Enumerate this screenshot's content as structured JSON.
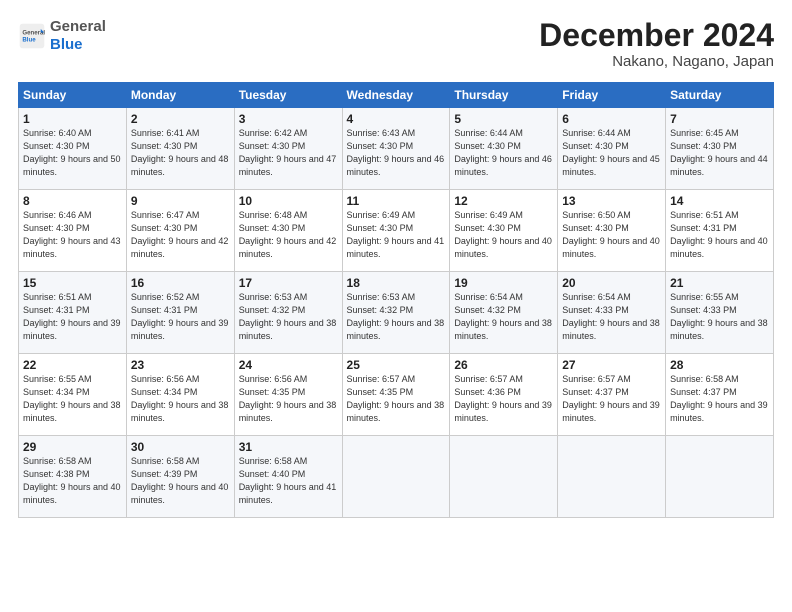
{
  "header": {
    "logo_general": "General",
    "logo_blue": "Blue",
    "title": "December 2024",
    "subtitle": "Nakano, Nagano, Japan"
  },
  "days_of_week": [
    "Sunday",
    "Monday",
    "Tuesday",
    "Wednesday",
    "Thursday",
    "Friday",
    "Saturday"
  ],
  "weeks": [
    [
      {
        "day": "1",
        "sunrise": "6:40 AM",
        "sunset": "4:30 PM",
        "daylight": "9 hours and 50 minutes."
      },
      {
        "day": "2",
        "sunrise": "6:41 AM",
        "sunset": "4:30 PM",
        "daylight": "9 hours and 48 minutes."
      },
      {
        "day": "3",
        "sunrise": "6:42 AM",
        "sunset": "4:30 PM",
        "daylight": "9 hours and 47 minutes."
      },
      {
        "day": "4",
        "sunrise": "6:43 AM",
        "sunset": "4:30 PM",
        "daylight": "9 hours and 46 minutes."
      },
      {
        "day": "5",
        "sunrise": "6:44 AM",
        "sunset": "4:30 PM",
        "daylight": "9 hours and 46 minutes."
      },
      {
        "day": "6",
        "sunrise": "6:44 AM",
        "sunset": "4:30 PM",
        "daylight": "9 hours and 45 minutes."
      },
      {
        "day": "7",
        "sunrise": "6:45 AM",
        "sunset": "4:30 PM",
        "daylight": "9 hours and 44 minutes."
      }
    ],
    [
      {
        "day": "8",
        "sunrise": "6:46 AM",
        "sunset": "4:30 PM",
        "daylight": "9 hours and 43 minutes."
      },
      {
        "day": "9",
        "sunrise": "6:47 AM",
        "sunset": "4:30 PM",
        "daylight": "9 hours and 42 minutes."
      },
      {
        "day": "10",
        "sunrise": "6:48 AM",
        "sunset": "4:30 PM",
        "daylight": "9 hours and 42 minutes."
      },
      {
        "day": "11",
        "sunrise": "6:49 AM",
        "sunset": "4:30 PM",
        "daylight": "9 hours and 41 minutes."
      },
      {
        "day": "12",
        "sunrise": "6:49 AM",
        "sunset": "4:30 PM",
        "daylight": "9 hours and 40 minutes."
      },
      {
        "day": "13",
        "sunrise": "6:50 AM",
        "sunset": "4:30 PM",
        "daylight": "9 hours and 40 minutes."
      },
      {
        "day": "14",
        "sunrise": "6:51 AM",
        "sunset": "4:31 PM",
        "daylight": "9 hours and 40 minutes."
      }
    ],
    [
      {
        "day": "15",
        "sunrise": "6:51 AM",
        "sunset": "4:31 PM",
        "daylight": "9 hours and 39 minutes."
      },
      {
        "day": "16",
        "sunrise": "6:52 AM",
        "sunset": "4:31 PM",
        "daylight": "9 hours and 39 minutes."
      },
      {
        "day": "17",
        "sunrise": "6:53 AM",
        "sunset": "4:32 PM",
        "daylight": "9 hours and 38 minutes."
      },
      {
        "day": "18",
        "sunrise": "6:53 AM",
        "sunset": "4:32 PM",
        "daylight": "9 hours and 38 minutes."
      },
      {
        "day": "19",
        "sunrise": "6:54 AM",
        "sunset": "4:32 PM",
        "daylight": "9 hours and 38 minutes."
      },
      {
        "day": "20",
        "sunrise": "6:54 AM",
        "sunset": "4:33 PM",
        "daylight": "9 hours and 38 minutes."
      },
      {
        "day": "21",
        "sunrise": "6:55 AM",
        "sunset": "4:33 PM",
        "daylight": "9 hours and 38 minutes."
      }
    ],
    [
      {
        "day": "22",
        "sunrise": "6:55 AM",
        "sunset": "4:34 PM",
        "daylight": "9 hours and 38 minutes."
      },
      {
        "day": "23",
        "sunrise": "6:56 AM",
        "sunset": "4:34 PM",
        "daylight": "9 hours and 38 minutes."
      },
      {
        "day": "24",
        "sunrise": "6:56 AM",
        "sunset": "4:35 PM",
        "daylight": "9 hours and 38 minutes."
      },
      {
        "day": "25",
        "sunrise": "6:57 AM",
        "sunset": "4:35 PM",
        "daylight": "9 hours and 38 minutes."
      },
      {
        "day": "26",
        "sunrise": "6:57 AM",
        "sunset": "4:36 PM",
        "daylight": "9 hours and 39 minutes."
      },
      {
        "day": "27",
        "sunrise": "6:57 AM",
        "sunset": "4:37 PM",
        "daylight": "9 hours and 39 minutes."
      },
      {
        "day": "28",
        "sunrise": "6:58 AM",
        "sunset": "4:37 PM",
        "daylight": "9 hours and 39 minutes."
      }
    ],
    [
      {
        "day": "29",
        "sunrise": "6:58 AM",
        "sunset": "4:38 PM",
        "daylight": "9 hours and 40 minutes."
      },
      {
        "day": "30",
        "sunrise": "6:58 AM",
        "sunset": "4:39 PM",
        "daylight": "9 hours and 40 minutes."
      },
      {
        "day": "31",
        "sunrise": "6:58 AM",
        "sunset": "4:40 PM",
        "daylight": "9 hours and 41 minutes."
      },
      null,
      null,
      null,
      null
    ]
  ]
}
